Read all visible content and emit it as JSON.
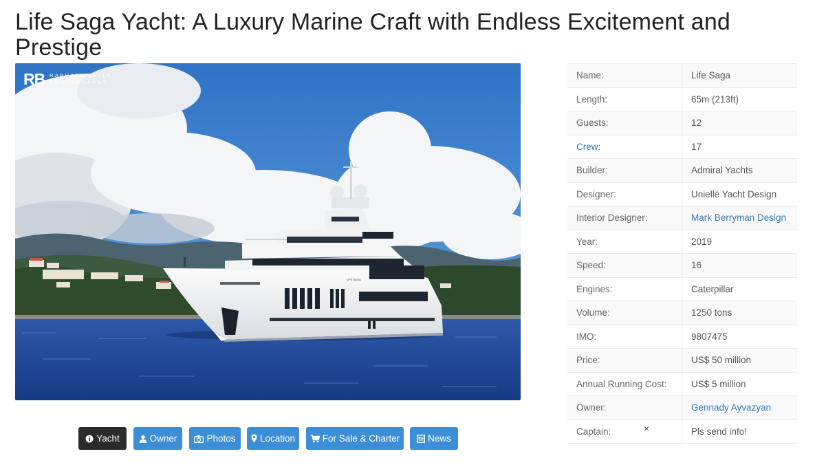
{
  "title": "Life Saga Yacht: A Luxury Marine Craft with Endless Excitement and Prestige",
  "photo": {
    "watermark_mark": "RB",
    "watermark_text": "RAPHAEL BELLY\nPHOTOGRAPHY",
    "hull_name": "LIFE SAGA"
  },
  "specs": [
    {
      "key": "Name:",
      "value": "Life Saga"
    },
    {
      "key": "Length:",
      "value": "65m (213ft)"
    },
    {
      "key": "Guests:",
      "value": "12"
    },
    {
      "key": "Crew:",
      "value": "17",
      "key_link": true
    },
    {
      "key": "Builder:",
      "value": "Admiral Yachts"
    },
    {
      "key": "Designer:",
      "value": "Uniellé Yacht Design"
    },
    {
      "key": "Interior Designer:",
      "value": "Mark Berryman Design",
      "value_link": true
    },
    {
      "key": "Year:",
      "value": "2019"
    },
    {
      "key": "Speed:",
      "value": "16"
    },
    {
      "key": "Engines:",
      "value": "Caterpillar"
    },
    {
      "key": "Volume:",
      "value": "1250 tons"
    },
    {
      "key": "IMO:",
      "value": "9807475"
    },
    {
      "key": "Price:",
      "value": "US$ 50 million"
    },
    {
      "key": "Annual Running Cost:",
      "value": "US$ 5 million"
    },
    {
      "key": "Owner:",
      "value": "Gennady Ayvazyan",
      "value_link": true
    },
    {
      "key": "Captain:",
      "value": "Pls send info!",
      "close": "×"
    }
  ],
  "tabs": [
    {
      "label": "Yacht",
      "icon": "info-circle-icon",
      "active": true
    },
    {
      "label": "Owner",
      "icon": "user-icon"
    },
    {
      "label": "Photos",
      "icon": "camera-icon"
    },
    {
      "label": "Location",
      "icon": "map-marker-icon"
    },
    {
      "label": "For Sale & Charter",
      "icon": "shopping-cart-icon"
    },
    {
      "label": "News",
      "icon": "newspaper-icon"
    }
  ],
  "colors": {
    "tab": "#3c8fd6",
    "tab_active": "#2b2b2b",
    "link": "#337ab7"
  }
}
